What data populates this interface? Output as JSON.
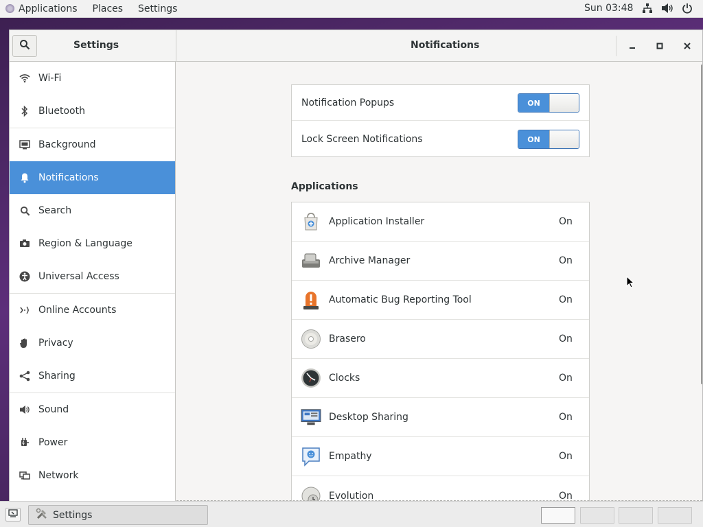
{
  "topbar": {
    "menus": [
      "Applications",
      "Places",
      "Settings"
    ],
    "clock": "Sun 03:48",
    "tray_icons": [
      "network-icon",
      "volume-icon",
      "power-icon"
    ]
  },
  "window": {
    "sidebar_title": "Settings",
    "page_title": "Notifications",
    "controls": [
      "minimize-icon",
      "maximize-icon",
      "close-icon"
    ]
  },
  "sidebar": {
    "items": [
      {
        "label": "Wi-Fi",
        "icon": "wifi-icon"
      },
      {
        "label": "Bluetooth",
        "icon": "bluetooth-icon"
      },
      {
        "label": "Background",
        "icon": "background-icon"
      },
      {
        "label": "Notifications",
        "icon": "bell-icon",
        "active": true
      },
      {
        "label": "Search",
        "icon": "search-icon"
      },
      {
        "label": "Region & Language",
        "icon": "camera-icon"
      },
      {
        "label": "Universal Access",
        "icon": "accessibility-icon"
      },
      {
        "label": "Online Accounts",
        "icon": "online-accounts-icon"
      },
      {
        "label": "Privacy",
        "icon": "hand-icon"
      },
      {
        "label": "Sharing",
        "icon": "share-icon"
      },
      {
        "label": "Sound",
        "icon": "speaker-icon"
      },
      {
        "label": "Power",
        "icon": "power-plug-icon"
      },
      {
        "label": "Network",
        "icon": "network-icon"
      }
    ]
  },
  "toggles": [
    {
      "label": "Notification Popups",
      "state": "ON"
    },
    {
      "label": "Lock Screen Notifications",
      "state": "ON"
    }
  ],
  "applications": {
    "heading": "Applications",
    "rows": [
      {
        "name": "Application Installer",
        "state": "On",
        "icon": "app-installer-icon"
      },
      {
        "name": "Archive Manager",
        "state": "On",
        "icon": "archive-manager-icon"
      },
      {
        "name": "Automatic Bug Reporting Tool",
        "state": "On",
        "icon": "bug-report-icon"
      },
      {
        "name": "Brasero",
        "state": "On",
        "icon": "disc-icon"
      },
      {
        "name": "Clocks",
        "state": "On",
        "icon": "clock-icon"
      },
      {
        "name": "Desktop Sharing",
        "state": "On",
        "icon": "desktop-sharing-icon"
      },
      {
        "name": "Empathy",
        "state": "On",
        "icon": "chat-icon"
      },
      {
        "name": "Evolution",
        "state": "On",
        "icon": "mail-icon"
      }
    ]
  },
  "taskbar": {
    "task_label": "Settings",
    "workspaces": 4,
    "active_workspace": 1
  },
  "colors": {
    "accent": "#4a90d9",
    "topbar_bg": "#f2f2f2",
    "window_bg": "#f6f5f4"
  }
}
